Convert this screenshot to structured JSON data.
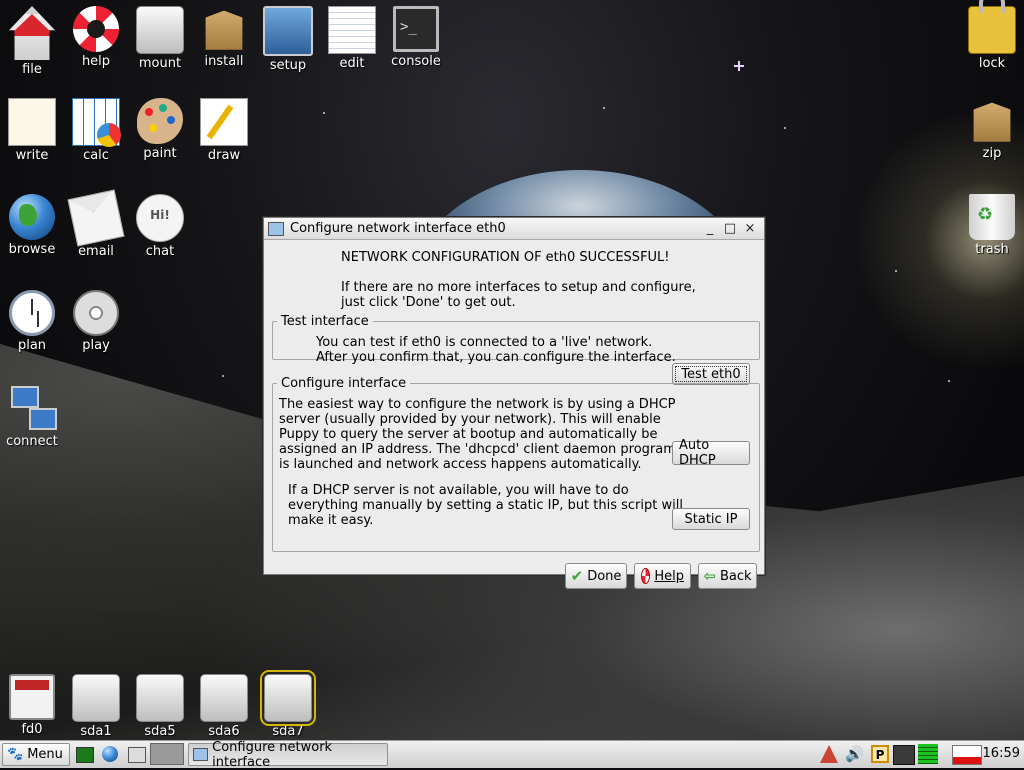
{
  "desktop": {
    "icons_left": [
      {
        "label": "file",
        "icon": "home-folder-icon"
      },
      {
        "label": "help",
        "icon": "lifebuoy-icon"
      },
      {
        "label": "mount",
        "icon": "drive-icon"
      },
      {
        "label": "install",
        "icon": "package-box-icon"
      },
      {
        "label": "setup",
        "icon": "monitor-tools-icon"
      },
      {
        "label": "edit",
        "icon": "notepad-pencil-icon"
      },
      {
        "label": "console",
        "icon": "terminal-icon"
      },
      {
        "label": "write",
        "icon": "document-icon"
      },
      {
        "label": "calc",
        "icon": "spreadsheet-icon"
      },
      {
        "label": "paint",
        "icon": "palette-icon"
      },
      {
        "label": "draw",
        "icon": "drawing-icon"
      },
      {
        "label": "browse",
        "icon": "globe-icon"
      },
      {
        "label": "email",
        "icon": "envelope-icon"
      },
      {
        "label": "chat",
        "icon": "speech-bubble-icon"
      },
      {
        "label": "plan",
        "icon": "clock-icon"
      },
      {
        "label": "play",
        "icon": "film-reel-icon"
      },
      {
        "label": "connect",
        "icon": "network-icon"
      }
    ],
    "icons_right": [
      {
        "label": "lock",
        "icon": "padlock-icon"
      },
      {
        "label": "zip",
        "icon": "archive-box-icon"
      },
      {
        "label": "trash",
        "icon": "trash-icon"
      }
    ],
    "drives": [
      {
        "label": "fd0",
        "icon": "floppy-icon"
      },
      {
        "label": "sda1",
        "icon": "drive-icon"
      },
      {
        "label": "sda5",
        "icon": "drive-icon"
      },
      {
        "label": "sda6",
        "icon": "drive-icon"
      },
      {
        "label": "sda7",
        "icon": "drive-icon",
        "selected": true
      }
    ],
    "chat_bubble_text": "Hi!",
    "console_prompt": ">_"
  },
  "dialog": {
    "title": "Configure network interface eth0",
    "minimize": "_",
    "maximize": "□",
    "close": "×",
    "success": "NETWORK CONFIGURATION OF eth0 SUCCESSFUL!",
    "intro_line1": "If there are no more interfaces to setup and configure,",
    "intro_line2": "just click 'Done' to get out.",
    "test_group": {
      "legend": "Test interface",
      "line1": "You can test if eth0 is connected to a 'live' network.",
      "line2": "After you confirm that, you can configure the interface.",
      "button": "Test eth0"
    },
    "configure_group": {
      "legend": "Configure interface",
      "dhcp_lines": [
        "The easiest way to configure the network is by using a DHCP",
        "server (usually provided by your network). This will enable",
        "Puppy to query the server at bootup and automatically be",
        "assigned an IP address. The 'dhcpcd' client daemon program",
        "is launched and network access happens automatically."
      ],
      "dhcp_button": "Auto DHCP",
      "static_lines": [
        "If a DHCP server is not available, you will have to do",
        "everything manually by setting a static IP, but this script will",
        "make it easy."
      ],
      "static_button": "Static IP"
    },
    "buttons": {
      "done": "Done",
      "help": "Help",
      "back": "Back"
    }
  },
  "taskbar": {
    "menu_label": "Menu",
    "task_label": "Configure network interface",
    "clock": "16:59",
    "tray_icons": [
      "firewall-icon",
      "volume-icon",
      "p-icon",
      "network-status-icon",
      "memory-icon",
      "cpu-graph-icon"
    ]
  }
}
